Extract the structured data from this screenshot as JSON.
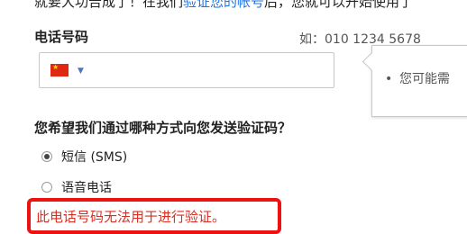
{
  "intro": {
    "text_before": "就要大功告成了！在我们",
    "link": "验证您的帐号",
    "text_after": "后，您就可以开始使用了"
  },
  "phone": {
    "label": "电话号码",
    "example": "如：010 1234 5678",
    "country_flag": "china-flag-icon",
    "value": "",
    "placeholder": ""
  },
  "tooltip": {
    "bullet": "•",
    "text": "您可能需"
  },
  "verification": {
    "question": "您希望我们通过哪种方式向您发送验证码？",
    "options": [
      {
        "label": "短信 (SMS)",
        "checked": true
      },
      {
        "label": "语音电话",
        "checked": false
      }
    ]
  },
  "error": {
    "message": "此电话号码无法用于进行验证。",
    "color": "#d93025",
    "border_color": "#ee1111"
  },
  "colors": {
    "link": "#1a73e8",
    "flag_red": "#de2910",
    "flag_star": "#ffde00"
  }
}
